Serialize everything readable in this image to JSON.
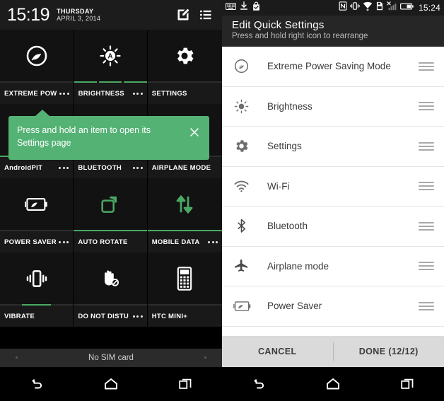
{
  "left_panel": {
    "header": {
      "time": "15:19",
      "day_of_week": "THURSDAY",
      "date": "APRIL 3, 2014",
      "edit_icon": "edit-pencil-icon",
      "list_icon": "list-menu-icon"
    },
    "tooltip": {
      "text": "Press and hold an item to open its Settings page",
      "close_icon": "close-x-icon",
      "background_color": "#55b275"
    },
    "tiles": [
      {
        "label": "EXTREME POW",
        "icon": "leaf-eco-icon",
        "active": false,
        "has_dots": true,
        "bar": "none"
      },
      {
        "label": "BRIGHTNESS",
        "icon": "brightness-auto-icon",
        "active": false,
        "has_dots": true,
        "bar": "segmented"
      },
      {
        "label": "SETTINGS",
        "icon": "gear-icon",
        "active": false,
        "has_dots": false,
        "bar": "none"
      },
      {
        "label": "AndroidPIT",
        "icon": "wifi-icon",
        "active": false,
        "has_dots": true,
        "bar": "full"
      },
      {
        "label": "BLUETOOTH",
        "icon": "bluetooth-icon",
        "active": false,
        "has_dots": true,
        "bar": "none"
      },
      {
        "label": "AIRPLANE MODE",
        "icon": "airplane-icon",
        "active": false,
        "has_dots": false,
        "bar": "none"
      },
      {
        "label": "POWER SAVER",
        "icon": "battery-leaf-icon",
        "active": false,
        "has_dots": true,
        "bar": "none"
      },
      {
        "label": "AUTO ROTATE",
        "icon": "auto-rotate-icon",
        "active": true,
        "has_dots": false,
        "bar": "full"
      },
      {
        "label": "MOBILE DATA",
        "icon": "data-arrows-icon",
        "active": true,
        "has_dots": true,
        "bar": "full"
      },
      {
        "label": "VIBRATE",
        "icon": "vibrate-icon",
        "active": false,
        "has_dots": false,
        "bar": "short"
      },
      {
        "label": "DO NOT DISTU",
        "icon": "do-not-disturb-icon",
        "active": false,
        "has_dots": true,
        "bar": "none"
      },
      {
        "label": "HTC MINI+",
        "icon": "htc-mini-icon",
        "active": false,
        "has_dots": false,
        "bar": "none"
      }
    ],
    "sim_status": "No SIM card",
    "navigation": {
      "back": "back-arrow-icon",
      "home": "home-icon",
      "recents": "recents-icon"
    },
    "accent_color": "#4aa863"
  },
  "right_panel": {
    "status_bar": {
      "left_icons": [
        "keyboard-icon",
        "download-icon",
        "shopping-bag-check-icon"
      ],
      "right_icons": [
        "nfc-icon",
        "vibrate-icon",
        "wifi-icon",
        "sd-card-icon",
        "signal-no-service-icon",
        "battery-icon"
      ],
      "time": "15:24"
    },
    "title": "Edit Quick Settings",
    "subtitle": "Press and hold right icon to rearrange",
    "items": [
      {
        "label": "Extreme Power Saving Mode",
        "icon": "leaf-eco-icon",
        "handle": "drag-handle-icon"
      },
      {
        "label": "Brightness",
        "icon": "brightness-icon",
        "handle": "drag-handle-icon"
      },
      {
        "label": "Settings",
        "icon": "gear-icon",
        "handle": "drag-handle-icon"
      },
      {
        "label": "Wi-Fi",
        "icon": "wifi-icon",
        "handle": "drag-handle-icon"
      },
      {
        "label": "Bluetooth",
        "icon": "bluetooth-icon",
        "handle": "drag-handle-icon"
      },
      {
        "label": "Airplane mode",
        "icon": "airplane-icon",
        "handle": "drag-handle-icon"
      },
      {
        "label": "Power Saver",
        "icon": "battery-leaf-icon",
        "handle": "drag-handle-icon"
      }
    ],
    "buttons": {
      "cancel": "CANCEL",
      "done": "DONE  (12/12)"
    },
    "navigation": {
      "back": "back-arrow-icon",
      "home": "home-icon",
      "recents": "recents-icon"
    }
  }
}
